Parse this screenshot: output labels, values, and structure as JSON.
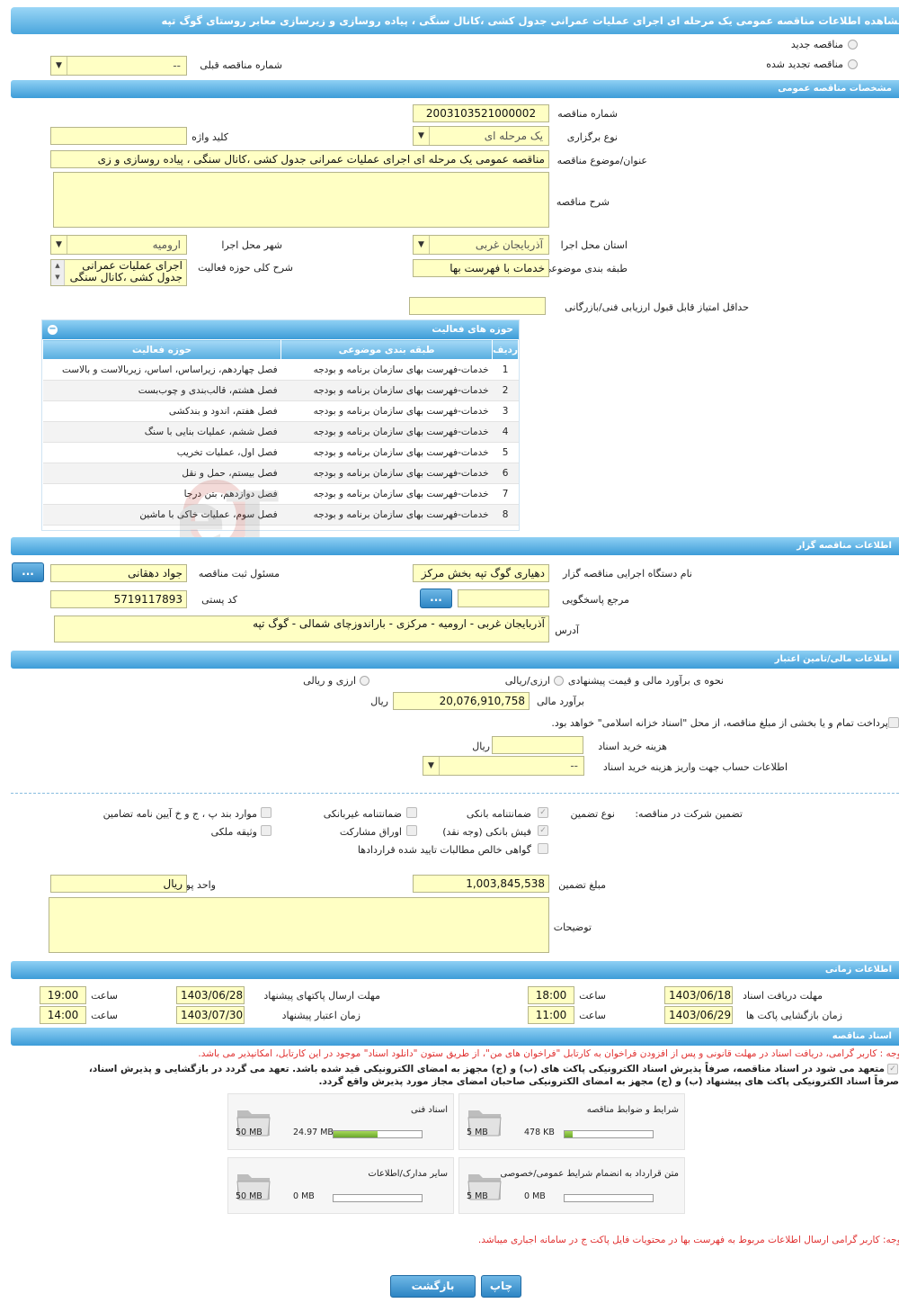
{
  "title": "مشاهده اطلاعات مناقصه عمومی یک مرحله ای اجرای عملیات عمرانی جدول کشی ،کانال سنگی ، پیاده روسازی و زیرسازی معابر روستای گوگ تپه",
  "top": {
    "new_tender": "مناقصه جدید",
    "renewed_tender": "مناقصه تجدید شده",
    "prev_number_label": "شماره مناقصه قبلی",
    "prev_number_value": "--"
  },
  "general": {
    "header": "مشخصات مناقصه عمومی",
    "tender_number_label": "شماره مناقصه",
    "tender_number": "2003103521000002",
    "holding_type_label": "نوع برگزاری",
    "holding_type": "یک مرحله ای",
    "keyword_label": "کلید واژه",
    "keyword": "",
    "subject_label": "عنوان/موضوع مناقصه",
    "subject": "مناقصه عمومی یک مرحله ای اجرای عملیات عمرانی جدول کشی ،کانال سنگی ، پیاده روسازی و زی",
    "description_label": "شرح مناقصه",
    "description": "",
    "province_label": "استان محل اجرا",
    "province": "آذربایجان غربی",
    "city_label": "شهر محل اجرا",
    "city": "ارومیه",
    "category_label": "طبقه بندی موضوعی",
    "category": "خدمات با فهرست بها",
    "scope_label": "شرح کلی حوزه فعالیت",
    "scope_line1": "اجرای عملیات عمرانی",
    "scope_line2": "جدول کشی ،کانال سنگی",
    "min_score_label": "حداقل امتیاز قابل قبول ارزیابی فنی/بازرگانی",
    "min_score": ""
  },
  "activities": {
    "header": "حوزه های فعالیت",
    "col_row": "ردیف",
    "col_category": "طبقه بندی موضوعی",
    "col_field": "حوزه فعالیت",
    "rows": [
      {
        "n": "1",
        "cat": "خدمات-فهرست بهای سازمان برنامه و بودجه",
        "field": "فصل چهاردهم، زیراساس، اساس، زیربالاست  و بالاست"
      },
      {
        "n": "2",
        "cat": "خدمات-فهرست بهای سازمان برنامه و بودجه",
        "field": "فصل هشتم، قالب‌بندی و چوب‌بست"
      },
      {
        "n": "3",
        "cat": "خدمات-فهرست بهای سازمان برنامه و بودجه",
        "field": "فصل هفتم، اندود و بندکشی"
      },
      {
        "n": "4",
        "cat": "خدمات-فهرست بهای سازمان برنامه و بودجه",
        "field": "فصل ششم، عملیات بنایی با سنگ"
      },
      {
        "n": "5",
        "cat": "خدمات-فهرست بهای سازمان برنامه و بودجه",
        "field": "فصل اول، عملیات تخریب"
      },
      {
        "n": "6",
        "cat": "خدمات-فهرست بهای سازمان برنامه و بودجه",
        "field": "فصل بیستم، حمل و نقل"
      },
      {
        "n": "7",
        "cat": "خدمات-فهرست بهای سازمان برنامه و بودجه",
        "field": "فصل دوازدهم، بتن درجا"
      },
      {
        "n": "8",
        "cat": "خدمات-فهرست بهای سازمان برنامه و بودجه",
        "field": "فصل سوم، عملیات خاکی با ماشین"
      }
    ]
  },
  "organizer": {
    "header": "اطلاعات مناقصه گزار",
    "org_label": "نام دستگاه اجرایی مناقصه گزار",
    "org": "دهیاری گوگ تپه بخش مرکز",
    "registrar_label": "مسئول ثبت مناقصه",
    "registrar": "جواد دهقانی",
    "responder_label": "مرجع پاسخگویی",
    "responder": "",
    "postal_label": "کد پستی",
    "postal": "5719117893",
    "address_label": "آدرس",
    "address": "آذربایجان غربی - ارومیه - مرکزی - باراندوزچای شمالی - گوگ تپه",
    "dots": "..."
  },
  "finance": {
    "header": "اطلاعات مالی/تامین اعتبار",
    "method_label": "نحوه ی برآورد مالی و قیمت پیشنهادی",
    "opt_currency_rial": "ارزی/ریالی",
    "opt_rial": "ارزی و ریالی",
    "estimate_label": "برآورد مالی",
    "estimate": "20,076,910,758",
    "rial": "ریال",
    "treasury_note": "پرداخت تمام و یا بخشی از مبلغ مناقصه، از محل \"اسناد خزانه اسلامی\" خواهد بود.",
    "doc_fee_label": "هزینه خرید اسناد",
    "doc_fee": "",
    "account_label": "اطلاعات حساب جهت واریز هزینه خرید اسناد",
    "account": "--"
  },
  "guarantee": {
    "participation_label": "تضمین شرکت در مناقصه:",
    "type_label": "نوع تضمین",
    "bank_guarantee": "ضمانتنامه بانکی",
    "nonbank_guarantee": "ضمانتنامه غیربانکی",
    "items_bpj": "موارد بند پ ، ج و خ آیین نامه تضامین",
    "bank_receipt": "فیش بانکی (وجه نقد)",
    "bonds": "اوراق مشارکت",
    "property": "وثیقه ملکی",
    "claims": "گواهی خالص مطالبات تایید شده قراردادها",
    "amount_label": "مبلغ تضمین",
    "amount": "1,003,845,538",
    "currency_label": "واحد پول",
    "currency": "ریال",
    "notes_label": "توضیحات",
    "notes": ""
  },
  "timing": {
    "header": "اطلاعات زمانی",
    "receive_label": "مهلت دریافت اسناد",
    "receive_date": "1403/06/18",
    "receive_time": "18:00",
    "send_label": "مهلت ارسال پاکتهای پیشنهاد",
    "send_date": "1403/06/28",
    "send_time": "19:00",
    "open_label": "زمان بازگشایی پاکت ها",
    "open_date": "1403/06/29",
    "open_time": "11:00",
    "valid_label": "زمان اعتبار پیشنهاد",
    "valid_date": "1403/07/30",
    "valid_time": "14:00",
    "hour": "ساعت"
  },
  "documents": {
    "header": "اسناد مناقصه",
    "note1": "توجه : کاربر گرامی، دریافت اسناد در مهلت قانونی و پس از افزودن فراخوان به کارتابل \"فراخوان های من\"، از طریق ستون \"دانلود اسناد\" موجود در این کارتابل، امکانپذیر می باشد.",
    "commit1": "متعهد می شود در اسناد مناقصه، صرفاً پذیرش اسناد الکترونیکی پاکت های (ب) و (ج) مجهز به امضای الکترونیکی قید شده باشد. تعهد می گردد در بازگشایی و پذیرش اسناد،",
    "commit2": "صرفاً اسناد الکترونیکی پاکت های پیشنهاد (ب) و (ج) مجهز به امضای الکترونیکی صاحبان امضای مجاز مورد پذیرش واقع گردد.",
    "files": [
      {
        "name": "شرایط و ضوابط مناقصه",
        "size": "478 KB",
        "max": "5 MB",
        "fill": 0.09
      },
      {
        "name": "اسناد فنی",
        "size": "24.97 MB",
        "max": "50 MB",
        "fill": 0.5
      },
      {
        "name": "متن قرارداد به انضمام شرایط عمومی/خصوصی",
        "size": "0 MB",
        "max": "5 MB",
        "fill": 0
      },
      {
        "name": "سایر مدارک/اطلاعات",
        "size": "0 MB",
        "max": "50 MB",
        "fill": 0
      }
    ],
    "note2": "توجه: کاربر گرامی ارسال اطلاعات مربوط به فهرست بها در محتویات فایل پاکت ج در سامانه اجباری میباشد."
  },
  "actions": {
    "print": "چاپ",
    "back": "بازگشت"
  },
  "watermark": "AriaTender.neT"
}
